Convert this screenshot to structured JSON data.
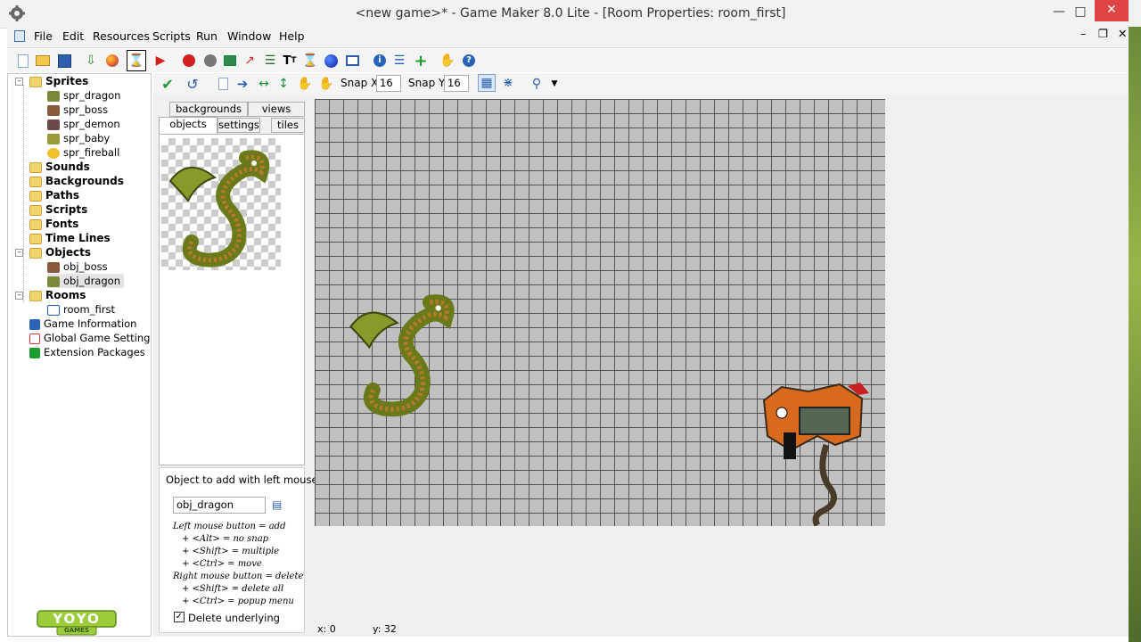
{
  "window": {
    "title": "<new game>* - Game Maker 8.0 Lite - [Room Properties: room_first]"
  },
  "menu": [
    "File",
    "Edit",
    "Resources",
    "Scripts",
    "Run",
    "Window",
    "Help"
  ],
  "resources": {
    "sprites": {
      "label": "Sprites",
      "items": [
        "spr_dragon",
        "spr_boss",
        "spr_demon",
        "spr_baby",
        "spr_fireball"
      ]
    },
    "sounds": "Sounds",
    "backgrounds": "Backgrounds",
    "paths": "Paths",
    "scripts": "Scripts",
    "fonts": "Fonts",
    "timelines": "Time Lines",
    "objects": {
      "label": "Objects",
      "items": [
        "obj_boss",
        "obj_dragon"
      ]
    },
    "rooms": {
      "label": "Rooms",
      "items": [
        "room_first"
      ]
    },
    "game_information": "Game Information",
    "global_settings": "Global Game Settings",
    "extension_packages": "Extension Packages"
  },
  "room_toolbar": {
    "snap_x_label": "Snap X:",
    "snap_x": "16",
    "snap_y_label": "Snap Y:",
    "snap_y": "16"
  },
  "tabs": {
    "backgrounds": "backgrounds",
    "views": "views",
    "objects": "objects",
    "settings": "settings",
    "tiles": "tiles"
  },
  "add_panel": {
    "label": "Object to add with left mouse:",
    "object": "obj_dragon",
    "hints": [
      "Left mouse button = add",
      "+ <Alt> = no snap",
      "+ <Shift> = multiple",
      "+ <Ctrl> = move",
      "Right mouse button = delete",
      "+ <Shift> = delete all",
      "+ <Ctrl> = popup menu"
    ],
    "delete_underlying": "Delete underlying",
    "delete_underlying_checked": true
  },
  "logo": {
    "text": "YOYO",
    "sub": "GAMES"
  },
  "status": {
    "x": "x: 0",
    "y": "y: 32"
  },
  "colors": {
    "room_bg": "#c0c0c0",
    "grid": "#555555",
    "logo_green": "#9ccc3c"
  }
}
